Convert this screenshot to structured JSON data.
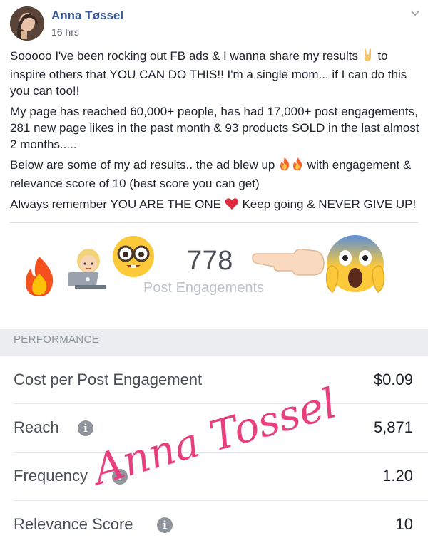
{
  "author": {
    "name": "Anna Tøssel",
    "time": "16 hrs"
  },
  "post": {
    "p1a": "Sooooo I've been rocking out FB ads & I wanna share my results ",
    "p1b": " to inspire others that YOU CAN DO THIS!! I'm a single mom... if I can do this you can too!!",
    "p2": "My page has reached 60,000+ people, has had 17,000+ post engagements, 281 new page likes in the past month & 93 products SOLD in the last almost 2 months.....",
    "p3a": "Below are some of my ad results.. the ad blew up ",
    "p3b": " with engagement & relevance score of 10 (best score you can get)",
    "p4a": "Always remember YOU ARE THE ONE ",
    "p4b": " Keep going & NEVER GIVE UP!"
  },
  "results": {
    "engagements": "778",
    "engagements_label": "Post Engagements",
    "performance_header": "PERFORMANCE",
    "metrics": [
      {
        "label": "Cost per Post Engagement",
        "value": "$0.09"
      },
      {
        "label": "Reach",
        "value": "5,871"
      },
      {
        "label": "Frequency",
        "value": "1.20"
      },
      {
        "label": "Relevance Score",
        "value": "10"
      }
    ]
  },
  "signature": "Anna Tossel",
  "colors": {
    "author_link": "#385898",
    "signature_pink": "#e8407e",
    "performance_bar": "#ebedf0"
  },
  "icons": [
    "avatar",
    "chevron-down-icon",
    "rock-on-hand-emoji",
    "fire-emoji",
    "red-heart-emoji",
    "woman-technologist-emoji",
    "nerd-face-emoji",
    "pointing-left-hand-emoji",
    "screaming-face-emoji",
    "info-icon"
  ]
}
